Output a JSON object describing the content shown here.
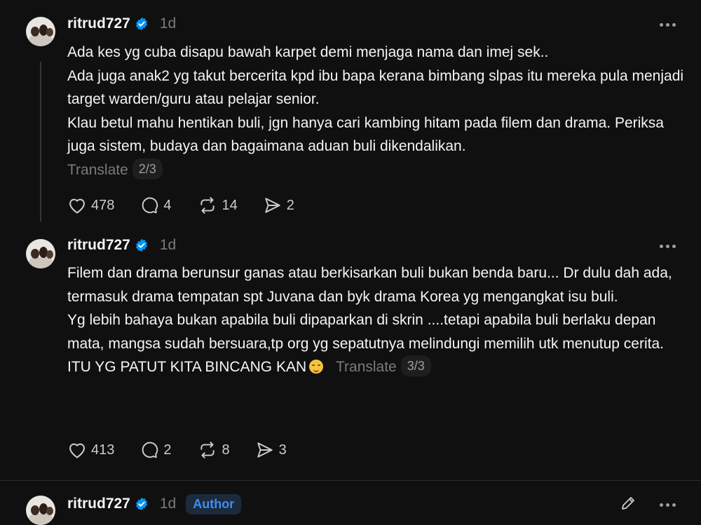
{
  "posts": [
    {
      "username": "ritrud727",
      "time": "1d",
      "lines": [
        "Ada kes yg cuba disapu bawah karpet demi menjaga nama dan imej sek..",
        "Ada juga anak2 yg takut bercerita kpd ibu bapa kerana bimbang slpas itu mereka pula menjadi target warden/guru atau pelajar senior.",
        "Klau betul mahu hentikan buli, jgn hanya cari kambing hitam pada filem dan drama. Periksa juga sistem, budaya dan bagaimana aduan buli dikendalikan."
      ],
      "translate": "Translate",
      "pager": "2/3",
      "likes": "478",
      "comments": "4",
      "reposts": "14",
      "shares": "2"
    },
    {
      "username": "ritrud727",
      "time": "1d",
      "lines": [
        "Filem dan drama berunsur ganas atau berkisarkan buli bukan benda baru... Dr dulu dah ada, termasuk drama tempatan spt Juvana dan byk drama Korea yg mengangkat isu buli.",
        "Yg lebih bahaya bukan apabila buli dipaparkan di skrin ....tetapi apabila buli berlaku depan mata, mangsa sudah bersuara,tp org yg sepatutnya melindungi memilih utk menutup cerita.",
        "ITU YG PATUT KITA BINCANG KAN"
      ],
      "translate": "Translate",
      "pager": "3/3",
      "likes": "413",
      "comments": "2",
      "reposts": "8",
      "shares": "3"
    },
    {
      "username": "ritrud727",
      "time": "1d",
      "badge": "Author"
    }
  ],
  "icons": [
    "verified-icon",
    "heart-icon",
    "comment-icon",
    "repost-icon",
    "share-icon",
    "more-icon",
    "edit-icon"
  ],
  "colors": {
    "background": "#101010",
    "text": "#f3f5f7",
    "muted": "#777b80",
    "verified": "#0095f6",
    "author": "#3d8ef0"
  }
}
